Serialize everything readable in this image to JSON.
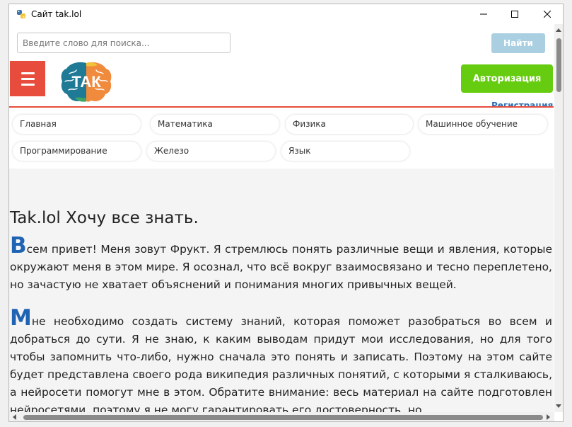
{
  "window": {
    "title": "Сайт tak.lol"
  },
  "search": {
    "placeholder": "Введите слово для поиска...",
    "button_label": "Найти"
  },
  "header": {
    "logo_text": "ТАК",
    "auth_label": "Авторизация",
    "register_label": "Регистрация"
  },
  "nav": {
    "items": [
      {
        "label": "Главная"
      },
      {
        "label": "Математика"
      },
      {
        "label": "Физика"
      },
      {
        "label": "Машинное обучение"
      },
      {
        "label": "Программирование"
      },
      {
        "label": "Железо"
      },
      {
        "label": "Язык"
      }
    ]
  },
  "main": {
    "title": "Tak.lol Хочу все знать.",
    "paragraphs": [
      {
        "dropcap": "В",
        "text": "сем привет! Меня зовут Фрукт. Я стремлюсь понять различные вещи и явления, которые окружают меня в этом мире. Я осознал, что всё вокруг взаимосвязано и тесно переплетено, но зачастую не хватает объяснений и понимания многих привычных вещей."
      },
      {
        "dropcap": "М",
        "text": "не необходимо создать систему знаний, которая поможет разобраться во всем и добраться до сути. Я не знаю, к каким выводам придут мои исследования, но для того чтобы запомнить что-либо, нужно сначала это понять и записать. Поэтому на этом сайте будет представлена своего рода википедия различных понятий, с которыми я сталкиваюсь, а нейросети помогут мне в этом. Обратите внимание: весь материал на сайте подготовлен нейросетями, поэтому я не могу гарантировать его достоверность, но"
      }
    ]
  },
  "colors": {
    "menu_red": "#e84c3d",
    "auth_green": "#66cc0f",
    "search_button": "#a9cfe1",
    "dropcap_blue": "#1f63b3",
    "link_blue": "#2f6fb5"
  },
  "icons": {
    "app": "python-app-icon",
    "menu": "hamburger-icon",
    "minimize": "minimize-icon",
    "maximize": "maximize-icon",
    "close": "close-icon"
  }
}
